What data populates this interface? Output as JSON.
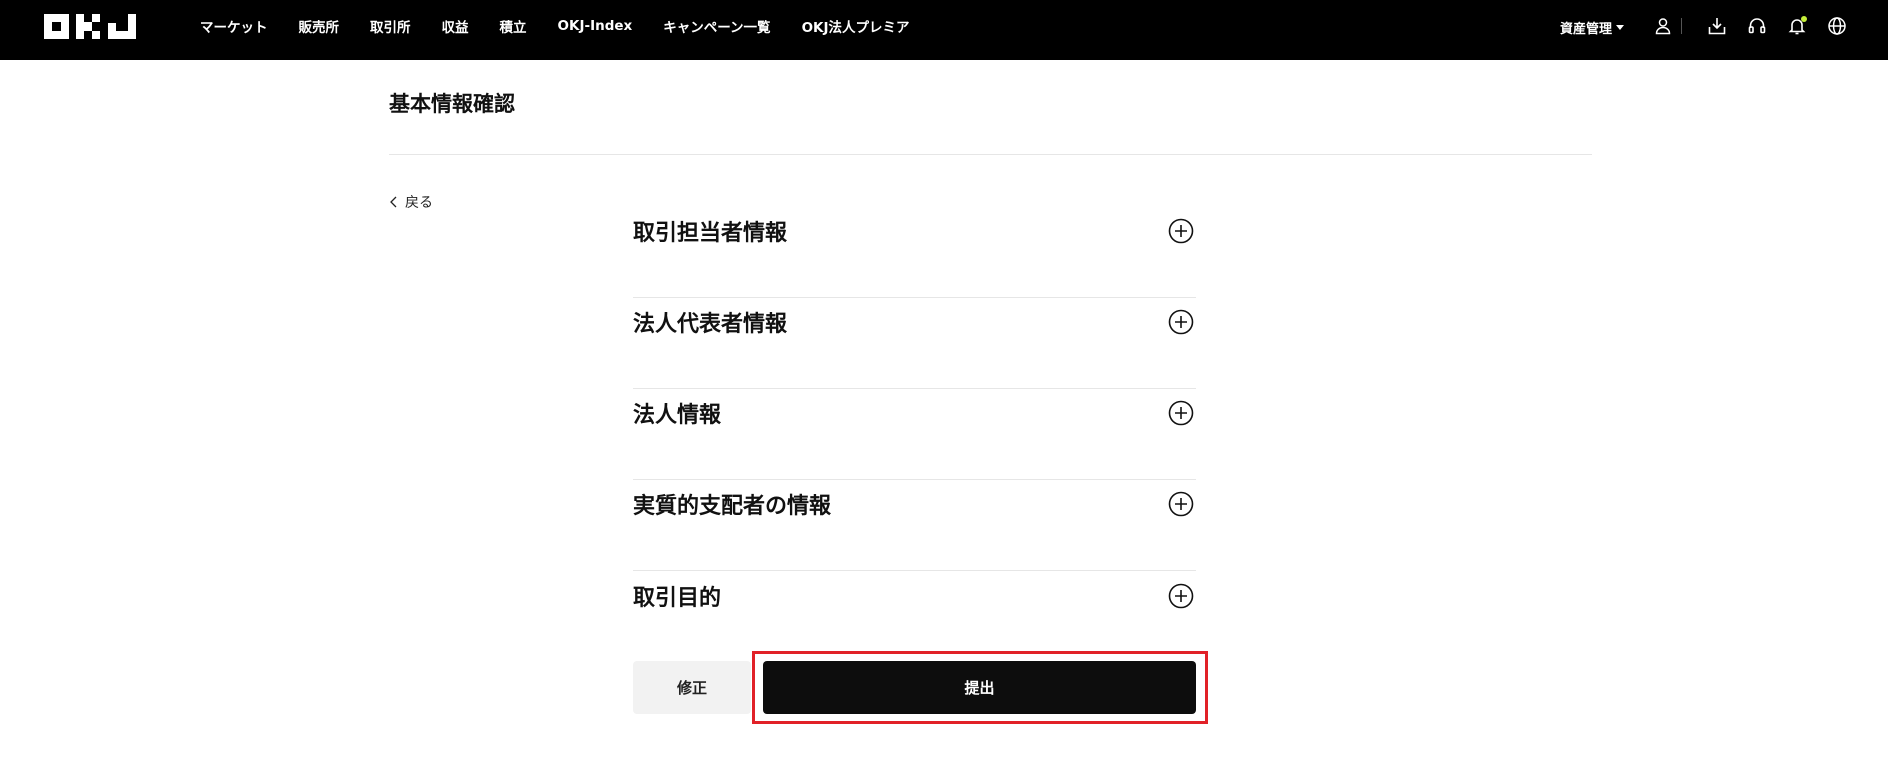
{
  "header": {
    "logo_text": "OKJ",
    "nav_items": [
      "マーケット",
      "販売所",
      "取引所",
      "収益",
      "積立",
      "OKJ-Index",
      "キャンペーン一覧",
      "OKJ法人プレミア"
    ],
    "asset_menu_label": "資産管理",
    "icons": [
      "user-icon",
      "download-icon",
      "support-headset-icon",
      "notification-bell-icon",
      "globe-icon"
    ],
    "notification_dot_color": "#c5ef3a"
  },
  "page": {
    "title": "基本情報確認",
    "back_label": "戻る"
  },
  "sections": [
    {
      "label": "取引担当者情報"
    },
    {
      "label": "法人代表者情報"
    },
    {
      "label": "法人情報"
    },
    {
      "label": "実質的支配者の情報"
    },
    {
      "label": "取引目的"
    }
  ],
  "actions": {
    "edit_label": "修正",
    "submit_label": "提出",
    "highlight_color": "#e12128"
  }
}
